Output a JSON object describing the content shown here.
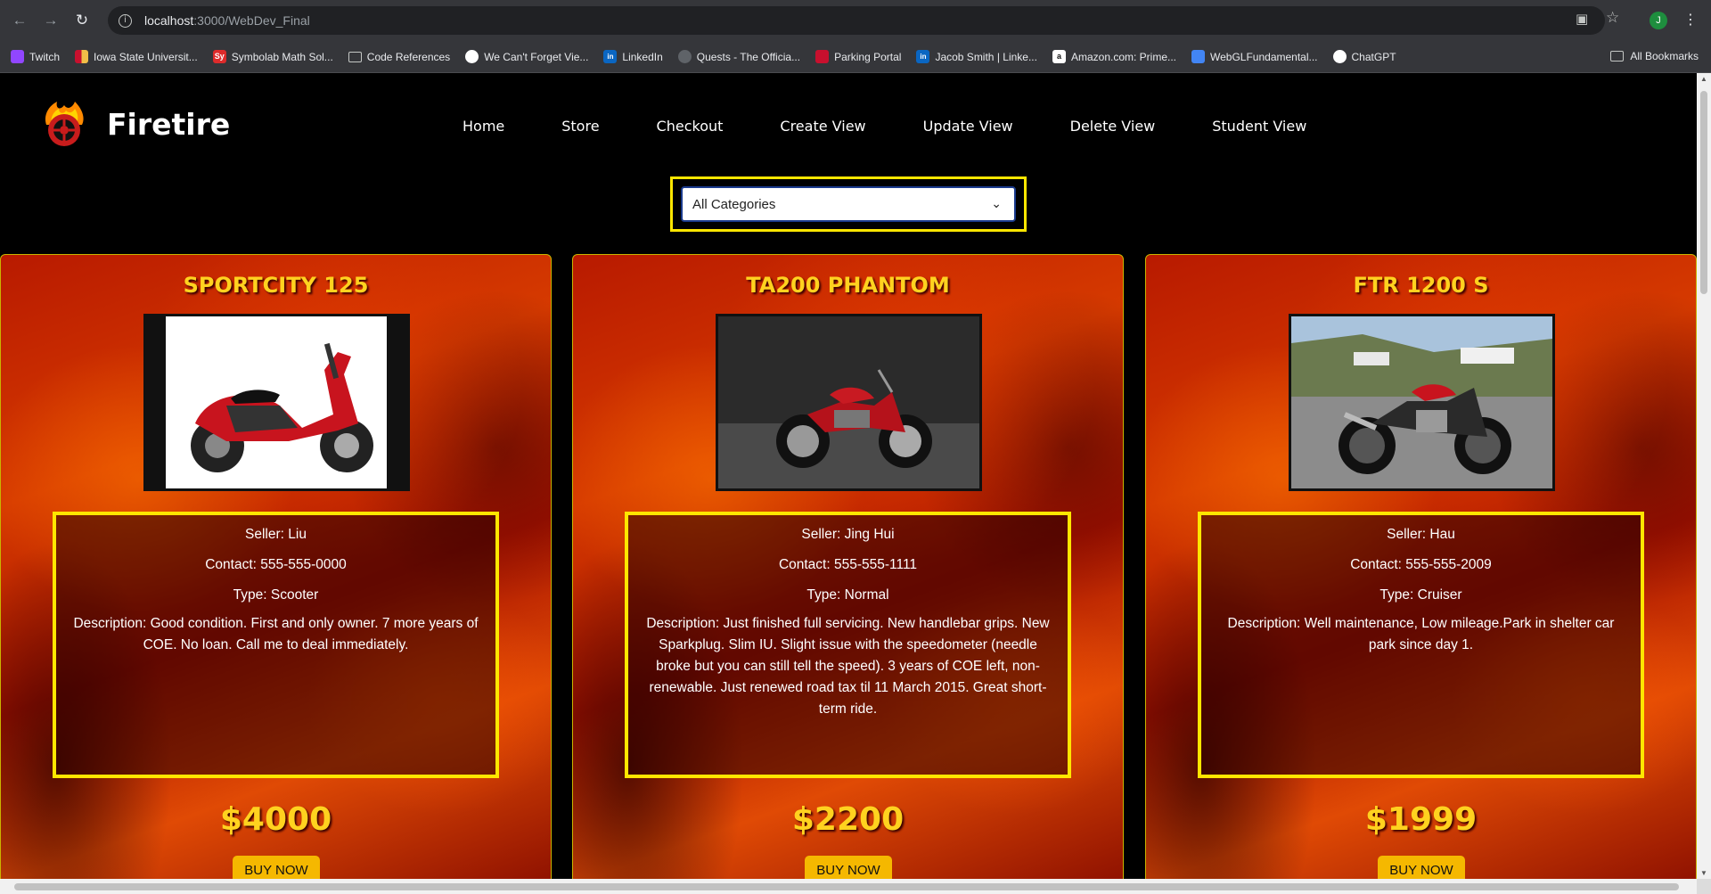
{
  "browser": {
    "url_host": "localhost",
    "url_rest": ":3000/WebDev_Final",
    "profile_initial": "J",
    "bookmarks": [
      {
        "label": "Twitch",
        "icon": "twitch",
        "glyph": ""
      },
      {
        "label": "Iowa State Universit...",
        "icon": "isu",
        "glyph": ""
      },
      {
        "label": "Symbolab Math Sol...",
        "icon": "sy",
        "glyph": "Sy"
      },
      {
        "label": "Code References",
        "icon": "folder",
        "glyph": ""
      },
      {
        "label": "We Can't Forget Vie...",
        "icon": "wcf",
        "glyph": ""
      },
      {
        "label": "LinkedIn",
        "icon": "li",
        "glyph": "in"
      },
      {
        "label": "Quests - The Officia...",
        "icon": "quests",
        "glyph": ""
      },
      {
        "label": "Parking Portal",
        "icon": "parking",
        "glyph": ""
      },
      {
        "label": "Jacob Smith | Linke...",
        "icon": "li",
        "glyph": "in"
      },
      {
        "label": "Amazon.com: Prime...",
        "icon": "amazon",
        "glyph": "a"
      },
      {
        "label": "WebGLFundamental...",
        "icon": "webgl",
        "glyph": ""
      },
      {
        "label": "ChatGPT",
        "icon": "gpt",
        "glyph": ""
      }
    ],
    "all_bookmarks": "All Bookmarks"
  },
  "site": {
    "brand": "Firetire",
    "nav": [
      "Home",
      "Store",
      "Checkout",
      "Create View",
      "Update View",
      "Delete View",
      "Student View"
    ],
    "category_select": "All Categories"
  },
  "listings": [
    {
      "title": "SPORTCITY 125",
      "seller": "Seller: Liu",
      "contact": "Contact: 555-555-0000",
      "type": "Type: Scooter",
      "description": "Description: Good condition. First and only owner. 7 more years of COE. No loan. Call me to deal immediately.",
      "price": "$4000",
      "buy": "BUY NOW"
    },
    {
      "title": "TA200 PHANTOM",
      "seller": "Seller: Jing Hui",
      "contact": "Contact: 555-555-1111",
      "type": "Type: Normal",
      "description": "Description: Just finished full servicing. New handlebar grips. New Sparkplug. Slim IU. Slight issue with the speedometer (needle broke but you can still tell the speed). 3 years of COE left, non-renewable. Just renewed road tax til 11 March 2015. Great short-term ride.",
      "price": "$2200",
      "buy": "BUY NOW"
    },
    {
      "title": "FTR 1200 S",
      "seller": "Seller: Hau",
      "contact": "Contact: 555-555-2009",
      "type": "Type: Cruiser",
      "description": "Description: Well maintenance, Low mileage.Park in shelter car park since day 1.",
      "price": "$1999",
      "buy": "BUY NOW"
    }
  ]
}
